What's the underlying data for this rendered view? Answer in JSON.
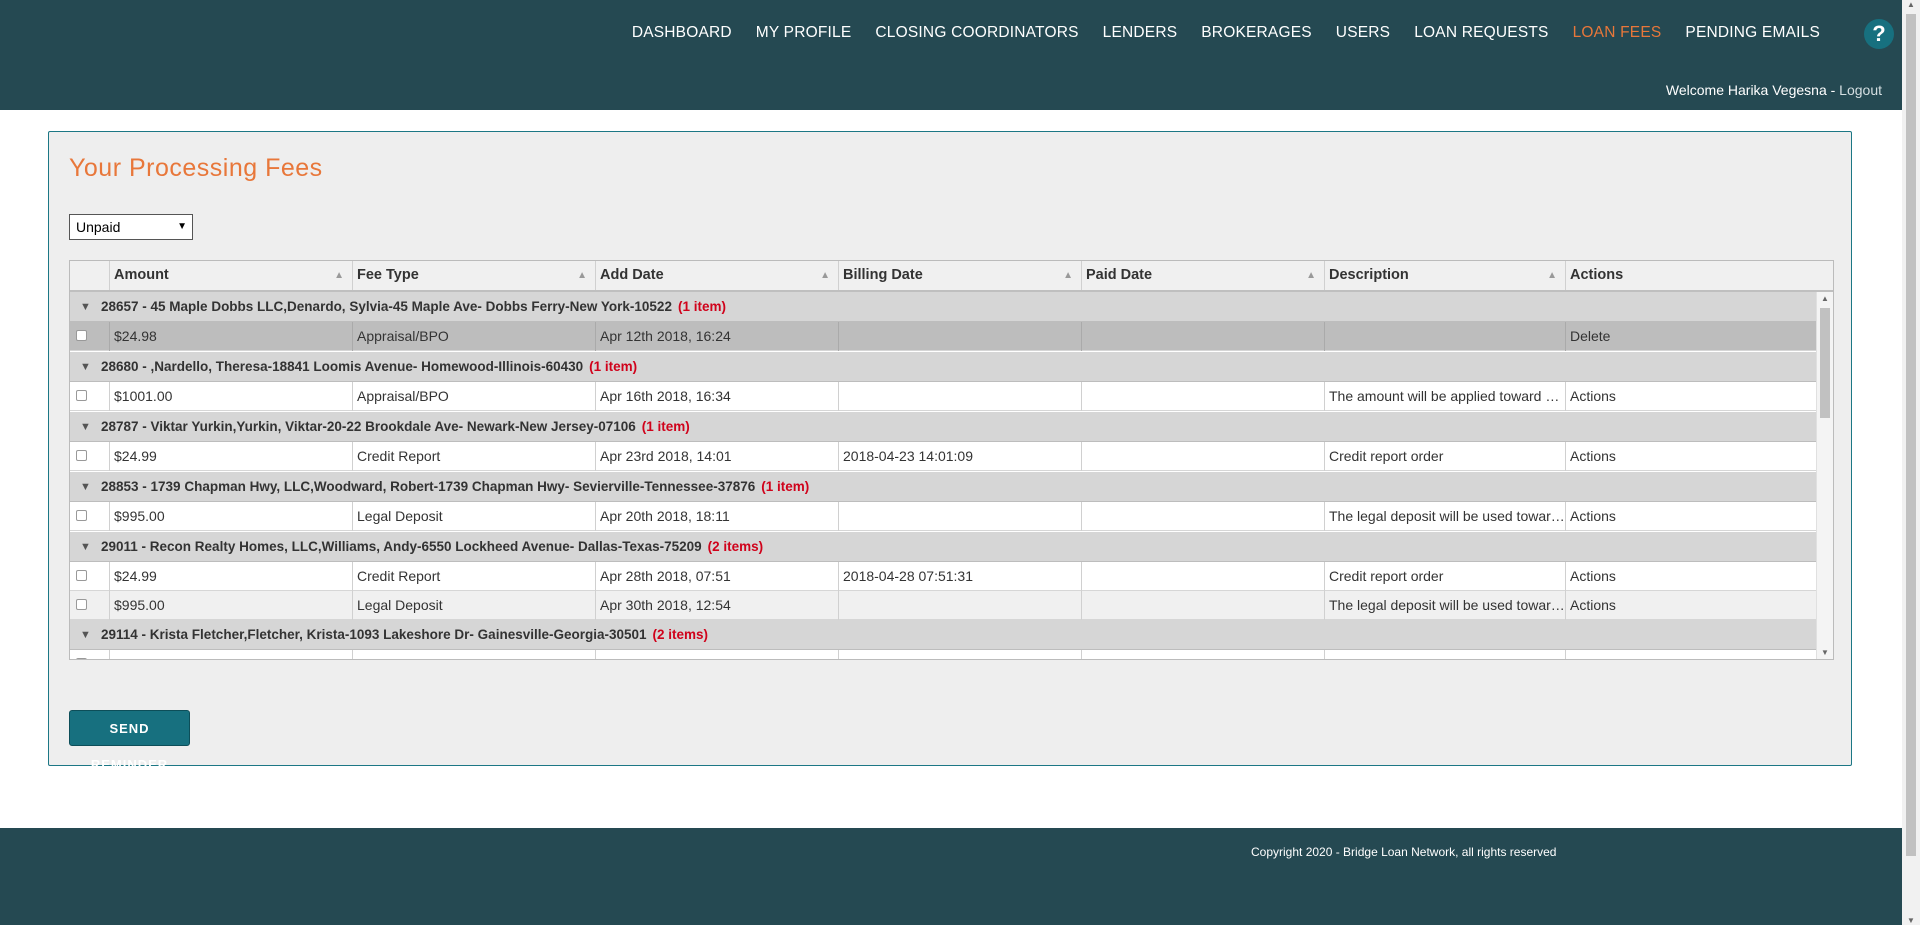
{
  "nav": {
    "items": [
      {
        "label": "DASHBOARD",
        "active": false
      },
      {
        "label": "MY PROFILE",
        "active": false
      },
      {
        "label": "CLOSING COORDINATORS",
        "active": false
      },
      {
        "label": "LENDERS",
        "active": false
      },
      {
        "label": "BROKERAGES",
        "active": false
      },
      {
        "label": "USERS",
        "active": false
      },
      {
        "label": "LOAN REQUESTS",
        "active": false
      },
      {
        "label": "LOAN FEES",
        "active": true
      },
      {
        "label": "PENDING EMAILS",
        "active": false
      }
    ],
    "help_label": "?",
    "welcome_text": "Welcome Harika Vegesna - ",
    "logout_label": "Logout"
  },
  "page": {
    "title": "Your Processing Fees",
    "filter_value": "Unpaid",
    "send_button": "SEND REMINDER"
  },
  "grid": {
    "columns": [
      "Amount",
      "Fee Type",
      "Add Date",
      "Billing Date",
      "Paid Date",
      "Description",
      "Actions"
    ],
    "groups": [
      {
        "title": "28657 - 45 Maple Dobbs LLC,Denardo, Sylvia-45 Maple Ave- Dobbs Ferry-New York-10522",
        "count": "(1 item)",
        "rows": [
          {
            "amount": "$24.98",
            "fee_type": "Appraisal/BPO",
            "add_date": "Apr 12th 2018, 16:24",
            "billing_date": "",
            "paid_date": "",
            "description": "",
            "actions": "Delete",
            "selected": true
          }
        ]
      },
      {
        "title": "28680 - ,Nardello, Theresa-18841 Loomis Avenue- Homewood-Illinois-60430",
        "count": "(1 item)",
        "rows": [
          {
            "amount": "$1001.00",
            "fee_type": "Appraisal/BPO",
            "add_date": "Apr 16th 2018, 16:34",
            "billing_date": "",
            "paid_date": "",
            "description": "The amount will be applied toward your appraisal",
            "actions": "Actions"
          }
        ]
      },
      {
        "title": "28787 - Viktar Yurkin,Yurkin, Viktar-20-22 Brookdale Ave- Newark-New Jersey-07106",
        "count": "(1 item)",
        "rows": [
          {
            "amount": "$24.99",
            "fee_type": "Credit Report",
            "add_date": "Apr 23rd 2018, 14:01",
            "billing_date": "2018-04-23 14:01:09",
            "paid_date": "",
            "description": "Credit report order",
            "actions": "Actions"
          }
        ]
      },
      {
        "title": "28853 - 1739 Chapman Hwy, LLC,Woodward, Robert-1739 Chapman Hwy- Sevierville-Tennessee-37876",
        "count": "(1 item)",
        "rows": [
          {
            "amount": "$995.00",
            "fee_type": "Legal Deposit",
            "add_date": "Apr 20th 2018, 18:11",
            "billing_date": "",
            "paid_date": "",
            "description": "The legal deposit will be used toward legal fees",
            "actions": "Actions"
          }
        ]
      },
      {
        "title": "29011 - Recon Realty Homes, LLC,Williams, Andy-6550 Lockheed Avenue- Dallas-Texas-75209",
        "count": "(2 items)",
        "rows": [
          {
            "amount": "$24.99",
            "fee_type": "Credit Report",
            "add_date": "Apr 28th 2018, 07:51",
            "billing_date": "2018-04-28 07:51:31",
            "paid_date": "",
            "description": "Credit report order",
            "actions": "Actions"
          },
          {
            "amount": "$995.00",
            "fee_type": "Legal Deposit",
            "add_date": "Apr 30th 2018, 12:54",
            "billing_date": "",
            "paid_date": "",
            "description": "The legal deposit will be used toward legal fees",
            "actions": "Actions",
            "alt": true
          }
        ]
      },
      {
        "title": "29114 - Krista Fletcher,Fletcher, Krista-1093 Lakeshore Dr- Gainesville-Georgia-30501",
        "count": "(2 items)",
        "rows": []
      }
    ]
  },
  "footer": {
    "copyright": "Copyright 2020 - Bridge Loan Network, all rights reserved"
  },
  "colors": {
    "header_bg": "#254952",
    "accent_orange": "#e8773a",
    "button_teal": "#17707f",
    "count_red": "#d0021b"
  }
}
